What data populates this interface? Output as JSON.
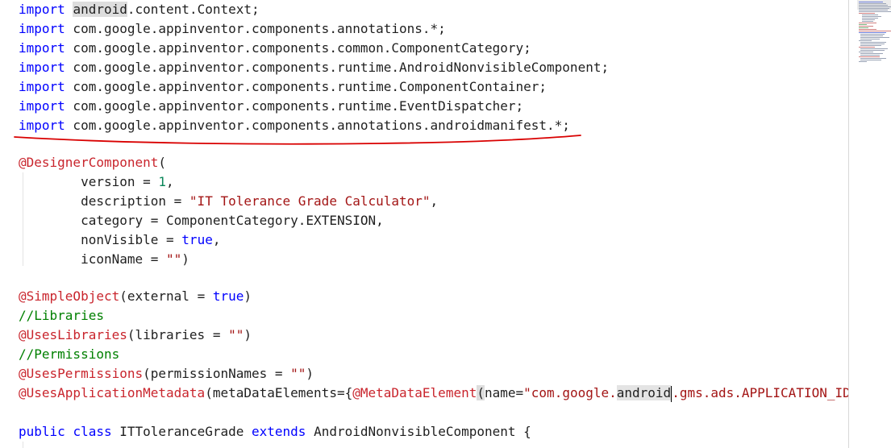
{
  "editor": {
    "lines": [
      {
        "parts": [
          [
            "kw",
            "import"
          ],
          [
            "plain",
            " "
          ],
          [
            "hl",
            "android"
          ],
          [
            "plain",
            ".content.Context;"
          ]
        ]
      },
      {
        "parts": [
          [
            "kw",
            "import"
          ],
          [
            "plain",
            " com.google.appinventor.components.annotations.*;"
          ]
        ]
      },
      {
        "parts": [
          [
            "kw",
            "import"
          ],
          [
            "plain",
            " com.google.appinventor.components.common.ComponentCategory;"
          ]
        ]
      },
      {
        "parts": [
          [
            "kw",
            "import"
          ],
          [
            "plain",
            " com.google.appinventor.components.runtime.AndroidNonvisibleComponent;"
          ]
        ]
      },
      {
        "parts": [
          [
            "kw",
            "import"
          ],
          [
            "plain",
            " com.google.appinventor.components.runtime.ComponentContainer;"
          ]
        ]
      },
      {
        "parts": [
          [
            "kw",
            "import"
          ],
          [
            "plain",
            " com.google.appinventor.components.runtime.EventDispatcher;"
          ]
        ]
      },
      {
        "parts": [
          [
            "kw",
            "import"
          ],
          [
            "plain",
            " com.google.appinventor.components.annotations.androidmanifest.*;"
          ]
        ]
      },
      {
        "parts": []
      },
      {
        "parts": [
          [
            "ann",
            "@DesignerComponent"
          ],
          [
            "plain",
            "("
          ]
        ]
      },
      {
        "parts": [
          [
            "plain",
            "        version = "
          ],
          [
            "num",
            "1"
          ],
          [
            "plain",
            ","
          ]
        ]
      },
      {
        "parts": [
          [
            "plain",
            "        description = "
          ],
          [
            "str",
            "\"IT Tolerance Grade Calculator\""
          ],
          [
            "plain",
            ","
          ]
        ]
      },
      {
        "parts": [
          [
            "plain",
            "        category = ComponentCategory.EXTENSION,"
          ]
        ]
      },
      {
        "parts": [
          [
            "plain",
            "        nonVisible = "
          ],
          [
            "kw",
            "true"
          ],
          [
            "plain",
            ","
          ]
        ]
      },
      {
        "parts": [
          [
            "plain",
            "        iconName = "
          ],
          [
            "str",
            "\"\""
          ],
          [
            "plain",
            ")"
          ]
        ]
      },
      {
        "parts": []
      },
      {
        "parts": [
          [
            "ann",
            "@SimpleObject"
          ],
          [
            "plain",
            "(external = "
          ],
          [
            "kw",
            "true"
          ],
          [
            "plain",
            ")"
          ]
        ]
      },
      {
        "parts": [
          [
            "cmt",
            "//Libraries"
          ]
        ]
      },
      {
        "parts": [
          [
            "ann",
            "@UsesLibraries"
          ],
          [
            "plain",
            "(libraries = "
          ],
          [
            "str",
            "\"\""
          ],
          [
            "plain",
            ")"
          ]
        ]
      },
      {
        "parts": [
          [
            "cmt",
            "//Permissions"
          ]
        ]
      },
      {
        "parts": [
          [
            "ann",
            "@UsesPermissions"
          ],
          [
            "plain",
            "(permissionNames = "
          ],
          [
            "str",
            "\"\""
          ],
          [
            "plain",
            ")"
          ]
        ]
      },
      {
        "parts": [
          [
            "ann",
            "@UsesApplicationMetadata"
          ],
          [
            "plain",
            "(metaDataElements={"
          ],
          [
            "ann",
            "@MetaDataElement"
          ],
          [
            "hl",
            "("
          ],
          [
            "plain",
            "name="
          ],
          [
            "str",
            "\"com.google."
          ],
          [
            "word",
            "android"
          ],
          [
            "cursor",
            ""
          ],
          [
            "str",
            ".gms.ads.APPLICATION_ID"
          ]
        ]
      },
      {
        "parts": []
      },
      {
        "parts": [
          [
            "kw",
            "public"
          ],
          [
            "plain",
            " "
          ],
          [
            "kw",
            "class"
          ],
          [
            "plain",
            " ITToleranceGrade "
          ],
          [
            "kw",
            "extends"
          ],
          [
            "plain",
            " AndroidNonvisibleComponent {"
          ]
        ]
      }
    ]
  },
  "colors": {
    "keyword": "#0000ff",
    "annotation": "#c9252d",
    "string": "#a31515",
    "number": "#098658",
    "comment": "#008000",
    "underline": "#d90000"
  }
}
